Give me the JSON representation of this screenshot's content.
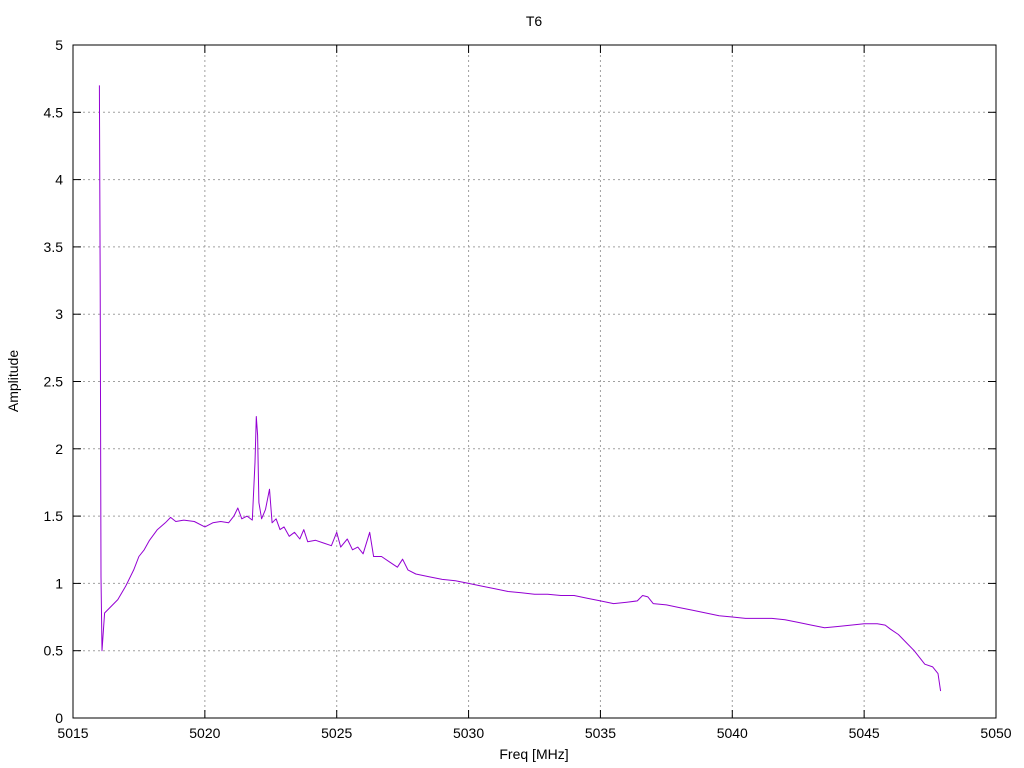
{
  "chart_data": {
    "type": "line",
    "title": "T6",
    "xlabel": "Freq [MHz]",
    "ylabel": "Amplitude",
    "xlim": [
      5015,
      5050
    ],
    "ylim": [
      0,
      5
    ],
    "xticks": [
      5015,
      5020,
      5025,
      5030,
      5035,
      5040,
      5045,
      5050
    ],
    "xtick_labels": [
      "5015",
      "5020",
      "5025",
      "5030",
      "5035",
      "5040",
      "5045",
      "5050"
    ],
    "yticks": [
      0,
      0.5,
      1,
      1.5,
      2,
      2.5,
      3,
      3.5,
      4,
      4.5,
      5
    ],
    "ytick_labels": [
      "0",
      "0.5",
      "1",
      "1.5",
      "2",
      "2.5",
      "3",
      "3.5",
      "4",
      "4.5",
      "5"
    ],
    "grid": true,
    "legend": "none",
    "series": [
      {
        "color": "#9400d3",
        "points": [
          [
            5016.0,
            4.7
          ],
          [
            5016.03,
            3.2
          ],
          [
            5016.06,
            1.05
          ],
          [
            5016.1,
            0.5
          ],
          [
            5016.2,
            0.78
          ],
          [
            5016.4,
            0.82
          ],
          [
            5016.7,
            0.88
          ],
          [
            5017.0,
            0.98
          ],
          [
            5017.3,
            1.1
          ],
          [
            5017.5,
            1.2
          ],
          [
            5017.7,
            1.25
          ],
          [
            5017.9,
            1.32
          ],
          [
            5018.2,
            1.4
          ],
          [
            5018.5,
            1.45
          ],
          [
            5018.7,
            1.49
          ],
          [
            5018.9,
            1.46
          ],
          [
            5019.2,
            1.47
          ],
          [
            5019.6,
            1.46
          ],
          [
            5020.0,
            1.42
          ],
          [
            5020.3,
            1.45
          ],
          [
            5020.6,
            1.46
          ],
          [
            5020.9,
            1.45
          ],
          [
            5021.1,
            1.5
          ],
          [
            5021.25,
            1.56
          ],
          [
            5021.4,
            1.48
          ],
          [
            5021.6,
            1.5
          ],
          [
            5021.8,
            1.47
          ],
          [
            5021.9,
            1.9
          ],
          [
            5021.95,
            2.24
          ],
          [
            5022.0,
            2.1
          ],
          [
            5022.05,
            1.6
          ],
          [
            5022.15,
            1.48
          ],
          [
            5022.3,
            1.55
          ],
          [
            5022.45,
            1.7
          ],
          [
            5022.55,
            1.45
          ],
          [
            5022.7,
            1.48
          ],
          [
            5022.85,
            1.4
          ],
          [
            5023.0,
            1.42
          ],
          [
            5023.2,
            1.35
          ],
          [
            5023.4,
            1.38
          ],
          [
            5023.6,
            1.33
          ],
          [
            5023.75,
            1.4
          ],
          [
            5023.9,
            1.31
          ],
          [
            5024.2,
            1.32
          ],
          [
            5024.5,
            1.3
          ],
          [
            5024.8,
            1.28
          ],
          [
            5025.0,
            1.38
          ],
          [
            5025.15,
            1.27
          ],
          [
            5025.4,
            1.33
          ],
          [
            5025.6,
            1.25
          ],
          [
            5025.8,
            1.27
          ],
          [
            5026.0,
            1.22
          ],
          [
            5026.25,
            1.38
          ],
          [
            5026.4,
            1.2
          ],
          [
            5026.7,
            1.2
          ],
          [
            5027.0,
            1.16
          ],
          [
            5027.3,
            1.12
          ],
          [
            5027.5,
            1.18
          ],
          [
            5027.7,
            1.1
          ],
          [
            5028.0,
            1.07
          ],
          [
            5028.5,
            1.05
          ],
          [
            5029.0,
            1.03
          ],
          [
            5029.5,
            1.02
          ],
          [
            5030.0,
            1.0
          ],
          [
            5030.5,
            0.98
          ],
          [
            5031.0,
            0.96
          ],
          [
            5031.5,
            0.94
          ],
          [
            5032.0,
            0.93
          ],
          [
            5032.5,
            0.92
          ],
          [
            5033.0,
            0.92
          ],
          [
            5033.5,
            0.91
          ],
          [
            5034.0,
            0.91
          ],
          [
            5034.5,
            0.89
          ],
          [
            5035.0,
            0.87
          ],
          [
            5035.5,
            0.85
          ],
          [
            5036.0,
            0.86
          ],
          [
            5036.4,
            0.87
          ],
          [
            5036.6,
            0.91
          ],
          [
            5036.8,
            0.9
          ],
          [
            5037.0,
            0.85
          ],
          [
            5037.5,
            0.84
          ],
          [
            5038.0,
            0.82
          ],
          [
            5038.5,
            0.8
          ],
          [
            5039.0,
            0.78
          ],
          [
            5039.5,
            0.76
          ],
          [
            5040.0,
            0.75
          ],
          [
            5040.5,
            0.74
          ],
          [
            5041.0,
            0.74
          ],
          [
            5041.5,
            0.74
          ],
          [
            5042.0,
            0.73
          ],
          [
            5042.5,
            0.71
          ],
          [
            5043.0,
            0.69
          ],
          [
            5043.5,
            0.67
          ],
          [
            5044.0,
            0.68
          ],
          [
            5044.5,
            0.69
          ],
          [
            5045.0,
            0.7
          ],
          [
            5045.5,
            0.7
          ],
          [
            5045.8,
            0.69
          ],
          [
            5046.0,
            0.66
          ],
          [
            5046.3,
            0.62
          ],
          [
            5046.6,
            0.56
          ],
          [
            5046.9,
            0.5
          ],
          [
            5047.1,
            0.45
          ],
          [
            5047.3,
            0.4
          ],
          [
            5047.6,
            0.38
          ],
          [
            5047.8,
            0.33
          ],
          [
            5047.9,
            0.2
          ]
        ]
      }
    ]
  }
}
